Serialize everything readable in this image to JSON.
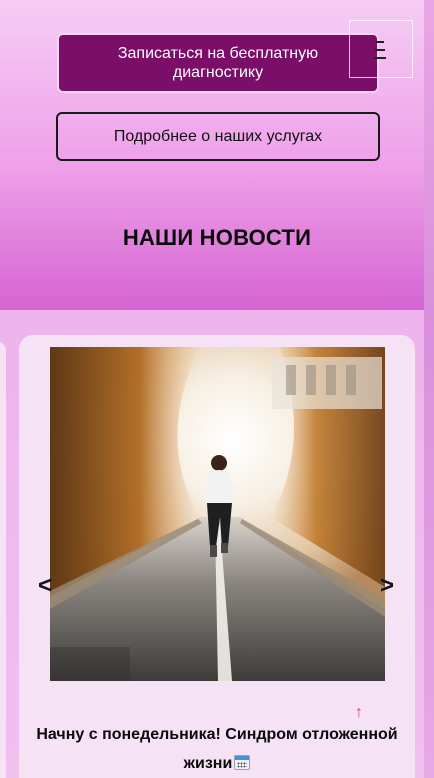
{
  "header": {
    "cta_button": "Записаться на бесплатную диагностику",
    "services_button": "Подробнее о наших услугах",
    "menu_icon": "hamburger-icon"
  },
  "news": {
    "section_title": "НАШИ НОВОСТИ",
    "prev_arrow": "<",
    "next_arrow": ">",
    "scroll_up_icon": "↑",
    "current_item": {
      "image_alt": "woman-running-on-road-photo",
      "title": "Начну с понедельника! Синдром отложенной жизни",
      "title_icon": "calendar-icon"
    }
  },
  "colors": {
    "cta_background": "#7a0e68",
    "page_gradient_top": "#f6cdf5",
    "page_gradient_bottom": "#d564d2",
    "card_background": "#f6e2f5",
    "scroll_up_color": "#e0457a"
  }
}
